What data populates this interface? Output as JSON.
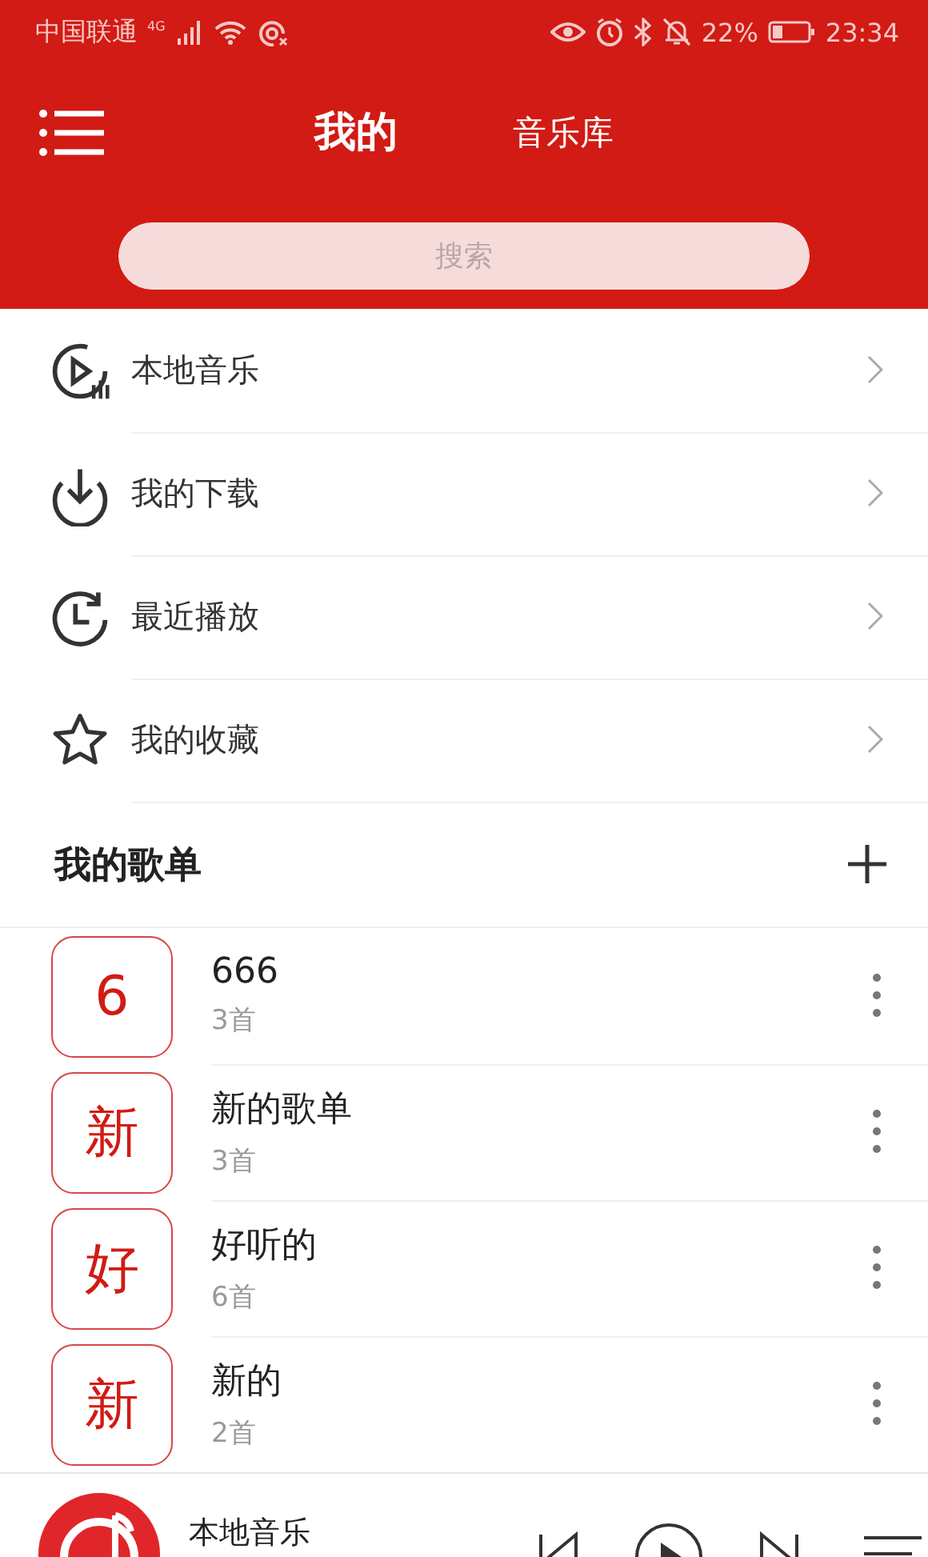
{
  "status_bar": {
    "carrier": "中国联通",
    "network": "4G",
    "battery": "22%",
    "time": "23:34"
  },
  "header": {
    "tabs": [
      {
        "label": "我的",
        "selected": true
      },
      {
        "label": "音乐库",
        "selected": false
      }
    ]
  },
  "search": {
    "placeholder": "搜索"
  },
  "menu": [
    {
      "label": "本地音乐"
    },
    {
      "label": "我的下载"
    },
    {
      "label": "最近播放"
    },
    {
      "label": "我的收藏"
    }
  ],
  "playlists_section": {
    "title": "我的歌单"
  },
  "playlists": [
    {
      "badge": "6",
      "name": "666",
      "count": "3首"
    },
    {
      "badge": "新",
      "name": "新的歌单",
      "count": "3首"
    },
    {
      "badge": "好",
      "name": "好听的",
      "count": "6首"
    },
    {
      "badge": "新",
      "name": "新的",
      "count": "2首"
    }
  ],
  "player": {
    "title": "本地音乐"
  }
}
